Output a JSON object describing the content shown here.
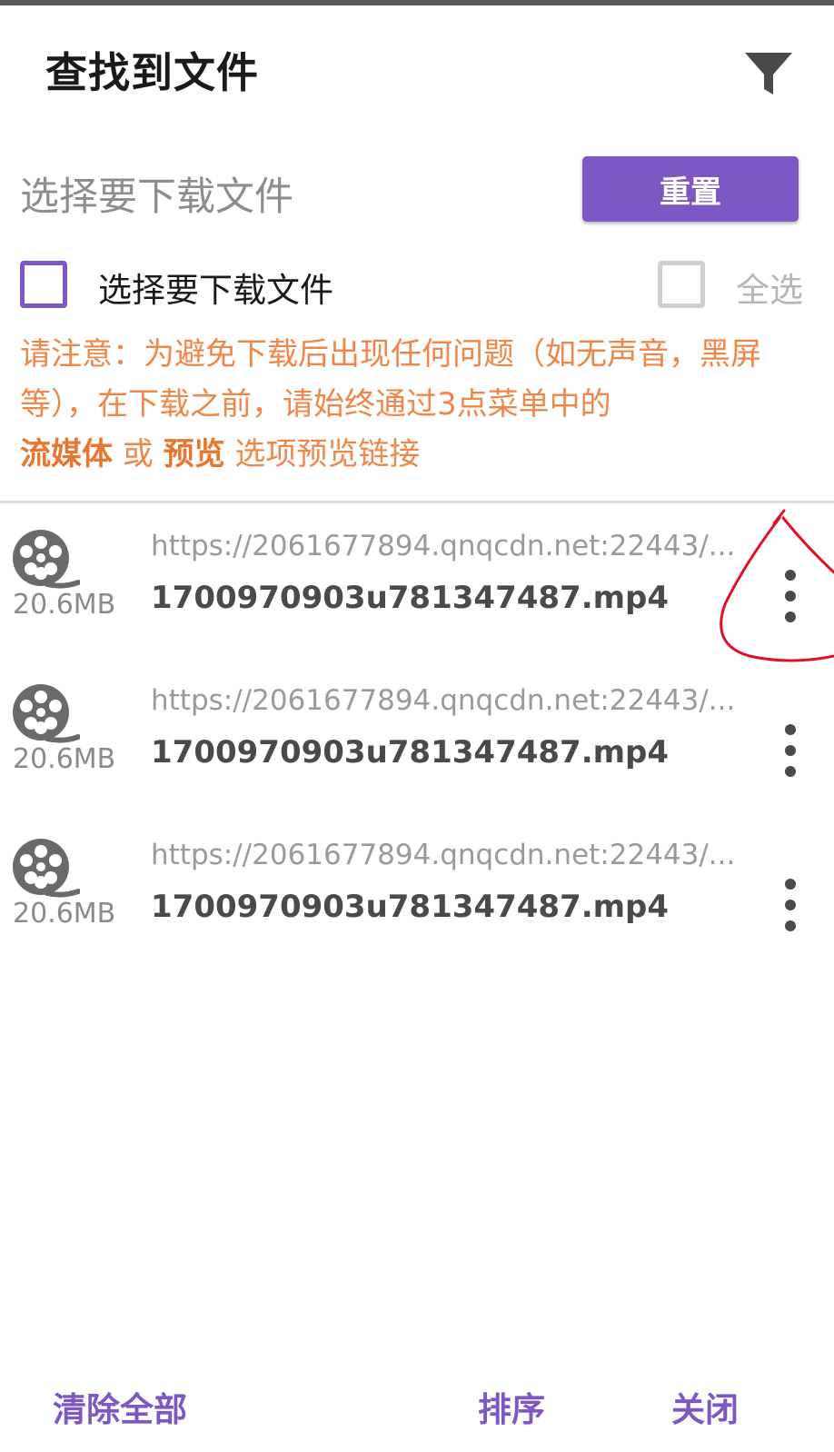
{
  "header": {
    "title": "查找到文件",
    "filter_icon": "filter-icon"
  },
  "toolbar": {
    "subtitle": "选择要下载文件",
    "reset_label": "重置"
  },
  "selection": {
    "label": "选择要下载文件",
    "checked": false,
    "select_all_label": "全选",
    "select_all_checked": false
  },
  "notice": {
    "text1": "请注意：为避免下载后出现任何问题（如无声音，黑屏等），在下载之前，请始终通过3点菜单中的",
    "bold1": "流媒体",
    "or": " 或 ",
    "bold2": "预览",
    "text2": " 选项预览链接"
  },
  "files": [
    {
      "url": "https://2061677894.qnqcdn.net:22443/...",
      "name": "1700970903u781347487.mp4",
      "size": "20.6MB",
      "icon": "film-reel-icon"
    },
    {
      "url": "https://2061677894.qnqcdn.net:22443/...",
      "name": "1700970903u781347487.mp4",
      "size": "20.6MB",
      "icon": "film-reel-icon"
    },
    {
      "url": "https://2061677894.qnqcdn.net:22443/...",
      "name": "1700970903u781347487.mp4",
      "size": "20.6MB",
      "icon": "film-reel-icon"
    }
  ],
  "footer": {
    "clear_all": "清除全部",
    "sort": "排序",
    "close": "关闭"
  },
  "colors": {
    "accent": "#7e57c2",
    "warning": "#f0874a",
    "annotation": "#e0102a"
  }
}
